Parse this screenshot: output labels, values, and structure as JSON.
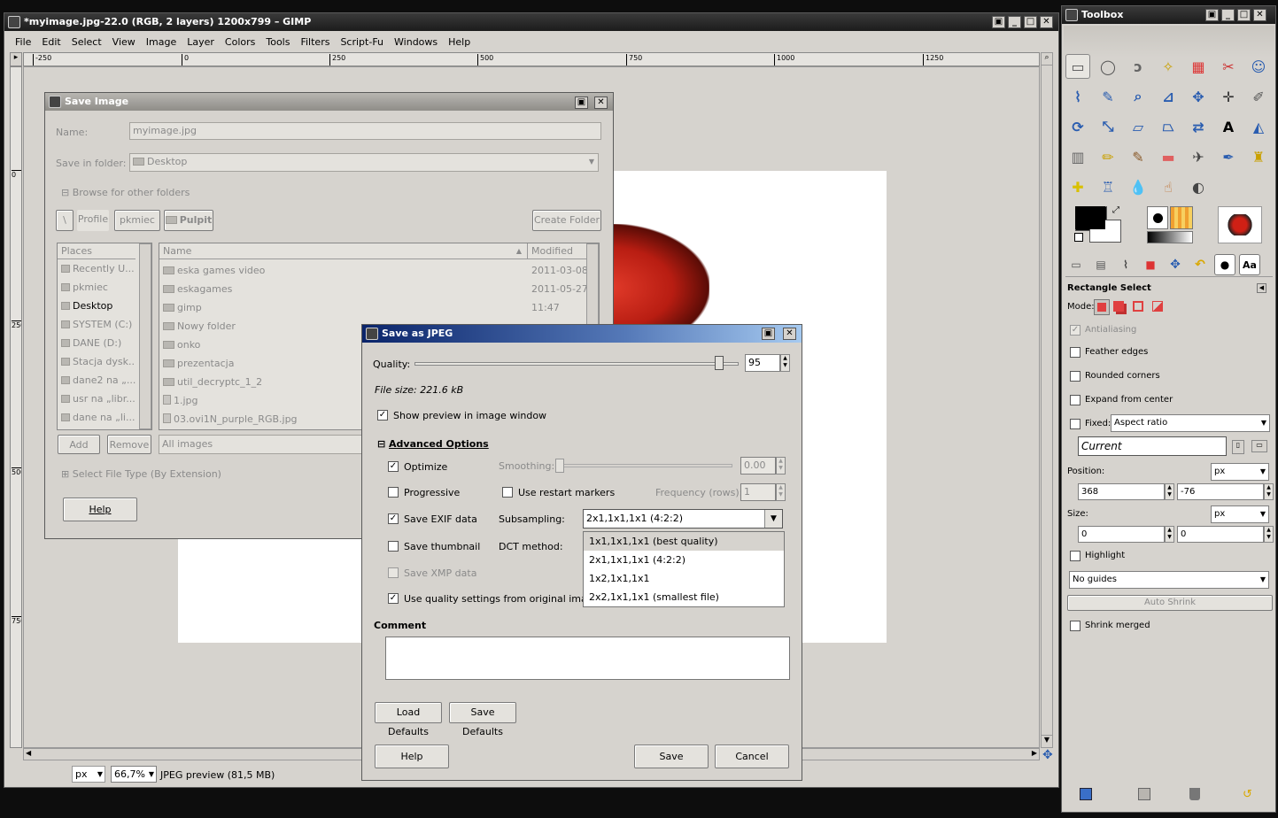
{
  "gimp": {
    "title": "*myimage.jpg-22.0 (RGB, 2 layers) 1200x799 – GIMP",
    "menu": [
      "File",
      "Edit",
      "Select",
      "View",
      "Image",
      "Layer",
      "Colors",
      "Tools",
      "Filters",
      "Script-Fu",
      "Windows",
      "Help"
    ],
    "ruler_top": [
      "-250",
      "0",
      "250",
      "500",
      "750",
      "1000",
      "1250"
    ],
    "ruler_left": [
      "0",
      "250",
      "500",
      "750"
    ],
    "status": {
      "unit": "px",
      "zoom": "66,7%",
      "info": "JPEG preview (81,5 MB)"
    }
  },
  "save_image": {
    "title": "Save Image",
    "name_label": "Name:",
    "name_value": "myimage.jpg",
    "folder_label": "Save in folder:",
    "folder_value": "Desktop",
    "browse": "Browse for other folders",
    "path": [
      "\\",
      "Profile",
      "pkmiec",
      "Pulpit"
    ],
    "create_folder": "Create Folder",
    "places_header": "Places",
    "places": [
      "Recently U...",
      "pkmiec",
      "Desktop",
      "SYSTEM (C:)",
      "DANE (D:)",
      "Stacja dysk...",
      "dane2 na „...",
      "usr na „libr...",
      "dane na „li..."
    ],
    "name_header": "Name",
    "modified_header": "Modified",
    "files": [
      {
        "name": "eska games video",
        "modified": "2011-03-08"
      },
      {
        "name": "eskagames",
        "modified": "2011-05-27"
      },
      {
        "name": "gimp",
        "modified": "11:47"
      },
      {
        "name": "Nowy folder",
        "modified": ""
      },
      {
        "name": "onko",
        "modified": ""
      },
      {
        "name": "prezentacja",
        "modified": ""
      },
      {
        "name": "util_decryptc_1_2",
        "modified": ""
      },
      {
        "name": "1.jpg",
        "modified": ""
      },
      {
        "name": "03.ovi1N_purple_RGB.jpg",
        "modified": ""
      }
    ],
    "add": "Add",
    "remove": "Remove",
    "filter": "All images",
    "file_type": "Select File Type (By Extension)",
    "help": "Help"
  },
  "jpeg": {
    "title": "Save as JPEG",
    "quality_label": "Quality:",
    "quality_value": "95",
    "file_size": "File size: 221.6 kB",
    "show_preview": "Show preview in image window",
    "advanced": "Advanced Options",
    "optimize": "Optimize",
    "smoothing_label": "Smoothing:",
    "smoothing_value": "0.00",
    "progressive": "Progressive",
    "restart": "Use restart markers",
    "frequency_label": "Frequency (rows):",
    "frequency_value": "1",
    "save_exif": "Save EXIF data",
    "subsampling_label": "Subsampling:",
    "subsampling_value": "2x1,1x1,1x1 (4:2:2)",
    "subsampling_options": [
      "1x1,1x1,1x1 (best quality)",
      "2x1,1x1,1x1 (4:2:2)",
      "1x2,1x1,1x1",
      "2x2,1x1,1x1 (smallest file)"
    ],
    "save_thumbnail": "Save thumbnail",
    "dct_label": "DCT method:",
    "save_xmp": "Save XMP data",
    "use_quality": "Use quality settings from original image",
    "comment_label": "Comment",
    "load_defaults": "Load Defaults",
    "save_defaults": "Save Defaults",
    "help": "Help",
    "save": "Save",
    "cancel": "Cancel"
  },
  "toolbox": {
    "title": "Toolbox",
    "options_title": "Rectangle Select",
    "mode_label": "Mode:",
    "antialiasing": "Antialiasing",
    "feather": "Feather edges",
    "rounded": "Rounded corners",
    "expand": "Expand from center",
    "fixed": "Fixed:",
    "fixed_value": "Aspect ratio",
    "current": "Current",
    "position_label": "Position:",
    "pos_unit": "px",
    "pos_x": "368",
    "pos_y": "-76",
    "size_label": "Size:",
    "size_unit": "px",
    "size_w": "0",
    "size_h": "0",
    "highlight": "Highlight",
    "guides": "No guides",
    "auto_shrink": "Auto Shrink",
    "shrink_merged": "Shrink merged",
    "opt_tabs": [
      "Aa"
    ]
  }
}
